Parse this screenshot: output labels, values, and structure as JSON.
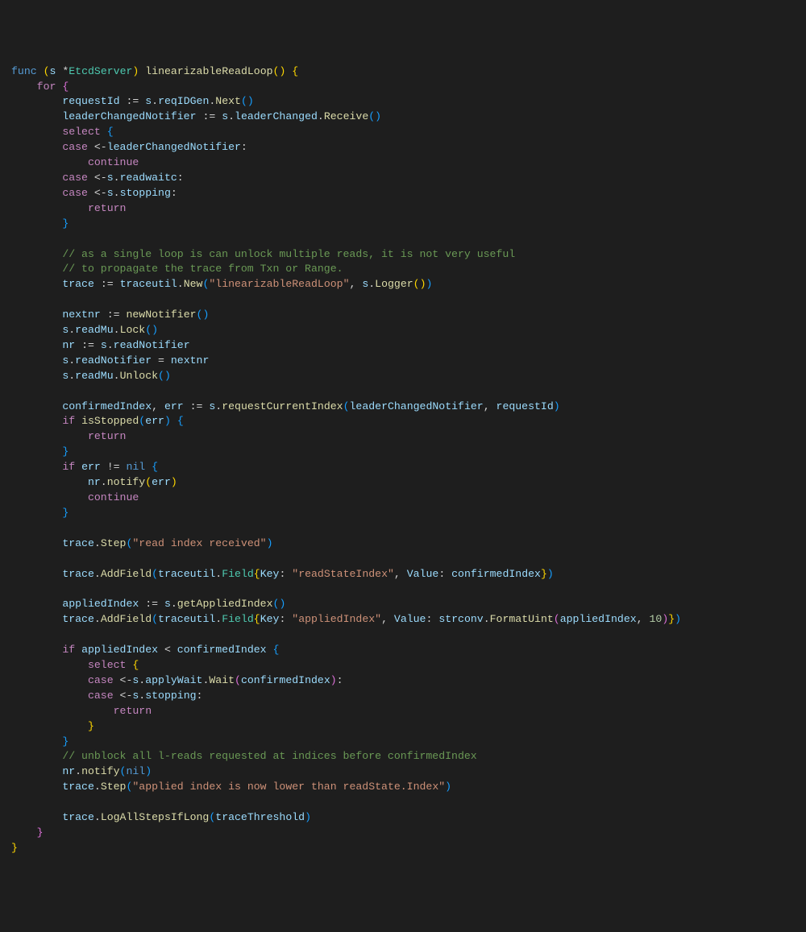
{
  "code": {
    "l1_func": "func",
    "l1_s": "s",
    "l1_star": "*",
    "l1_type": "EtcdServer",
    "l1_name": "linearizableReadLoop",
    "l2_for": "for",
    "l3_reqid": "requestId",
    "l3_assign": ":=",
    "l3_s": "s",
    "l3_reqidgen": "reqIDGen",
    "l3_next": "Next",
    "l4_lcn": "leaderChangedNotifier",
    "l4_s": "s",
    "l4_lc": "leaderChanged",
    "l4_recv": "Receive",
    "l5_select": "select",
    "l6_case": "case",
    "l6_arrow": "<-",
    "l6_lcn": "leaderChangedNotifier",
    "l7_continue": "continue",
    "l8_case": "case",
    "l8_s": "s",
    "l8_readwaitc": "readwaitc",
    "l9_case": "case",
    "l9_s": "s",
    "l9_stopping": "stopping",
    "l10_return": "return",
    "l13_cmt": "// as a single loop is can unlock multiple reads, it is not very useful",
    "l14_cmt": "// to propagate the trace from Txn or Range.",
    "l15_trace": "trace",
    "l15_tu": "traceutil",
    "l15_new": "New",
    "l15_str": "\"linearizableReadLoop\"",
    "l15_s": "s",
    "l15_logger": "Logger",
    "l17_nextnr": "nextnr",
    "l17_newnot": "newNotifier",
    "l18_s": "s",
    "l18_readmu": "readMu",
    "l18_lock": "Lock",
    "l19_nr": "nr",
    "l19_s": "s",
    "l19_readnot": "readNotifier",
    "l20_s": "s",
    "l20_readnot": "readNotifier",
    "l20_nextnr": "nextnr",
    "l21_s": "s",
    "l21_readmu": "readMu",
    "l21_unlock": "Unlock",
    "l23_ci": "confirmedIndex",
    "l23_err": "err",
    "l23_s": "s",
    "l23_rci": "requestCurrentIndex",
    "l23_lcn": "leaderChangedNotifier",
    "l23_reqid": "requestId",
    "l24_if": "if",
    "l24_isstopped": "isStopped",
    "l24_err": "err",
    "l25_return": "return",
    "l27_if": "if",
    "l27_err": "err",
    "l27_nil": "nil",
    "l28_nr": "nr",
    "l28_notify": "notify",
    "l28_err": "err",
    "l29_continue": "continue",
    "l32_trace": "trace",
    "l32_step": "Step",
    "l32_str": "\"read index received\"",
    "l34_trace": "trace",
    "l34_add": "AddField",
    "l34_tu": "traceutil",
    "l34_field": "Field",
    "l34_key": "Key",
    "l34_keystr": "\"readStateIndex\"",
    "l34_val": "Value",
    "l34_ci": "confirmedIndex",
    "l36_ai": "appliedIndex",
    "l36_s": "s",
    "l36_gai": "getAppliedIndex",
    "l37_trace": "trace",
    "l37_add": "AddField",
    "l37_tu": "traceutil",
    "l37_field": "Field",
    "l37_key": "Key",
    "l37_keystr": "\"appliedIndex\"",
    "l37_val": "Value",
    "l37_strconv": "strconv",
    "l37_fu": "FormatUint",
    "l37_ai": "appliedIndex",
    "l37_ten": "10",
    "l39_if": "if",
    "l39_ai": "appliedIndex",
    "l39_ci": "confirmedIndex",
    "l40_select": "select",
    "l41_case": "case",
    "l41_s": "s",
    "l41_aw": "applyWait",
    "l41_wait": "Wait",
    "l41_ci": "confirmedIndex",
    "l42_case": "case",
    "l42_s": "s",
    "l42_stopping": "stopping",
    "l43_return": "return",
    "l46_cmt": "// unblock all l-reads requested at indices before confirmedIndex",
    "l47_nr": "nr",
    "l47_notify": "notify",
    "l47_nil": "nil",
    "l48_trace": "trace",
    "l48_step": "Step",
    "l48_str": "\"applied index is now lower than readState.Index\"",
    "l50_trace": "trace",
    "l50_log": "LogAllStepsIfLong",
    "l50_tt": "traceThreshold"
  }
}
